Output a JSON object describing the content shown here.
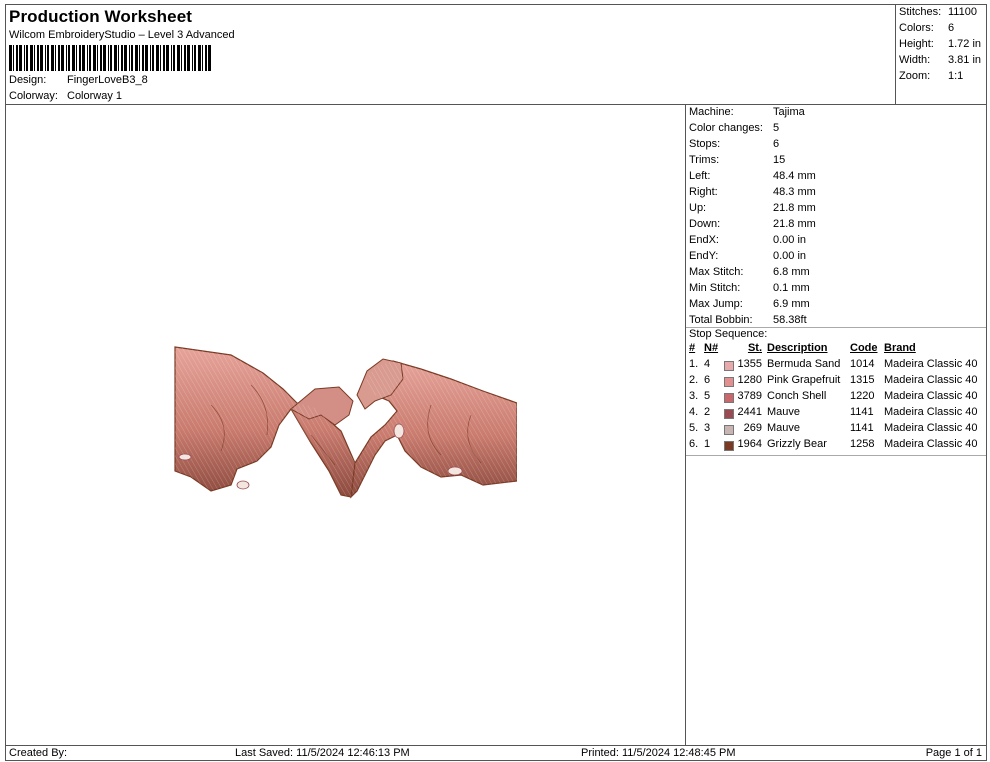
{
  "header": {
    "title": "Production Worksheet",
    "subtitle": "Wilcom EmbroideryStudio – Level 3 Advanced",
    "design_label": "Design:",
    "design_value": "FingerLoveB3_8",
    "colorway_label": "Colorway:",
    "colorway_value": "Colorway 1"
  },
  "stats": [
    {
      "label": "Stitches:",
      "value": "11100"
    },
    {
      "label": "Colors:",
      "value": "6"
    },
    {
      "label": "Height:",
      "value": "1.72 in"
    },
    {
      "label": "Width:",
      "value": "3.81 in"
    },
    {
      "label": "Zoom:",
      "value": "1:1"
    }
  ],
  "properties": [
    {
      "label": "Machine:",
      "value": "Tajima"
    },
    {
      "label": "Color changes:",
      "value": "5"
    },
    {
      "label": "Stops:",
      "value": "6"
    },
    {
      "label": "Trims:",
      "value": "15"
    },
    {
      "label": "Left:",
      "value": "48.4 mm"
    },
    {
      "label": "Right:",
      "value": "48.3 mm"
    },
    {
      "label": "Up:",
      "value": "21.8 mm"
    },
    {
      "label": "Down:",
      "value": "21.8 mm"
    },
    {
      "label": "EndX:",
      "value": "0.00 in"
    },
    {
      "label": "EndY:",
      "value": "0.00 in"
    },
    {
      "label": "Max Stitch:",
      "value": "6.8 mm"
    },
    {
      "label": "Min Stitch:",
      "value": "0.1 mm"
    },
    {
      "label": "Max Jump:",
      "value": "6.9 mm"
    },
    {
      "label": "Total Bobbin:",
      "value": "58.38ft"
    }
  ],
  "stop_sequence": {
    "title": "Stop Sequence:",
    "headers": {
      "idx": "#",
      "n": "N#",
      "st": "St.",
      "desc": "Description",
      "code": "Code",
      "brand": "Brand"
    },
    "rows": [
      {
        "idx": "1.",
        "n": "4",
        "st": "1355",
        "desc": "Bermuda Sand",
        "code": "1014",
        "brand": "Madeira Classic 40",
        "color": "#e8a9ad"
      },
      {
        "idx": "2.",
        "n": "6",
        "st": "1280",
        "desc": "Pink Grapefruit",
        "code": "1315",
        "brand": "Madeira Classic 40",
        "color": "#e28f8f"
      },
      {
        "idx": "3.",
        "n": "5",
        "st": "3789",
        "desc": "Conch Shell",
        "code": "1220",
        "brand": "Madeira Classic 40",
        "color": "#c8686c"
      },
      {
        "idx": "4.",
        "n": "2",
        "st": "2441",
        "desc": "Mauve",
        "code": "1141",
        "brand": "Madeira Classic 40",
        "color": "#9a4a52"
      },
      {
        "idx": "5.",
        "n": "3",
        "st": "269",
        "desc": "Mauve",
        "code": "1141",
        "brand": "Madeira Classic 40",
        "color": "#c9b4b4"
      },
      {
        "idx": "6.",
        "n": "1",
        "st": "1964",
        "desc": "Grizzly Bear",
        "code": "1258",
        "brand": "Madeira Classic 40",
        "color": "#7a3a24"
      }
    ]
  },
  "footer": {
    "created": "Created By:",
    "saved": "Last Saved: 11/5/2024 12:46:13 PM",
    "printed": "Printed: 11/5/2024 12:48:45 PM",
    "page": "Page 1 of 1"
  }
}
